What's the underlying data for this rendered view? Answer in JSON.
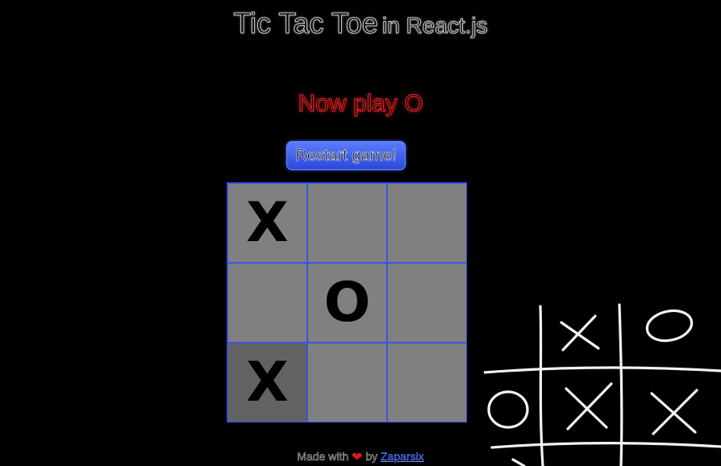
{
  "header": {
    "title_main": "Tic Tac Toe",
    "title_sub": "in React.js"
  },
  "status": {
    "text": "Now play O"
  },
  "controls": {
    "restart_label": "Restart game!"
  },
  "board": {
    "cells": [
      "X",
      "",
      "",
      "",
      "O",
      "",
      "X",
      "",
      ""
    ],
    "highlighted_cell_index": 6
  },
  "decoration": {
    "icon": "hand-drawn-tic-tac-toe-board"
  },
  "footer": {
    "made_with": "Made with",
    "heart": "❤",
    "by": "by",
    "author": "Zaparsix"
  },
  "colors": {
    "background": "#000000",
    "status_text": "#e02020",
    "button": "#3a5bff",
    "grid_line": "#2d49d8",
    "cell": "#808080",
    "cell_highlight": "#626262"
  }
}
